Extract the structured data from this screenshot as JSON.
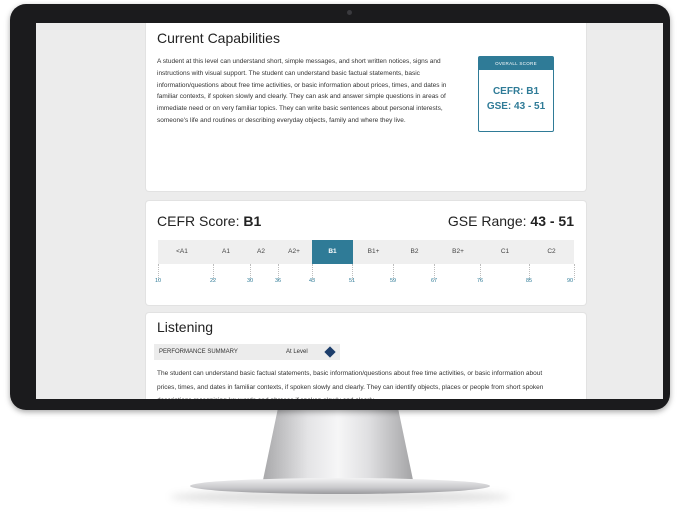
{
  "capabilities": {
    "title": "Current Capabilities",
    "text": "A student at this level can understand short, simple messages, and short written notices, signs and instructions with visual support. The student can understand basic factual statements, basic information/questions about free time activities, or basic information about prices, times, and dates in familiar contexts, if spoken slowly and clearly. They can ask and answer simple questions in areas of immediate need or on very familiar topics. They can write basic sentences about personal interests, someone's life and routines or describing everyday objects, family and where they live.",
    "overall": {
      "header": "OVERALL SCORE",
      "cefr_line": "CEFR: B1",
      "gse_line": "GSE: 43 - 51"
    }
  },
  "cefr": {
    "score_label": "CEFR Score:",
    "score_value": "B1",
    "range_label": "GSE Range:",
    "range_value": "43 - 51",
    "levels": [
      "<A1",
      "A1",
      "A2",
      "A2+",
      "B1",
      "B1+",
      "B2",
      "B2+",
      "C1",
      "C2"
    ],
    "active_level": "B1",
    "ticks": [
      "10",
      "22",
      "30",
      "36",
      "43",
      "51",
      "59",
      "67",
      "76",
      "85",
      "90"
    ]
  },
  "listening": {
    "title": "Listening",
    "summary_label": "PERFORMANCE SUMMARY",
    "summary_value": "At Level",
    "text": "The student can understand basic factual statements, basic information/questions about free time activities, or basic information about prices, times, and dates in familiar contexts, if spoken slowly and clearly. They can identify objects, places or people from short spoken descriptions recognising keywords and phrases if spoken slowly and clearly."
  },
  "colors": {
    "accent": "#2f7b97",
    "diamond": "#1c3d6b",
    "bezel": "#1b1b1d"
  }
}
